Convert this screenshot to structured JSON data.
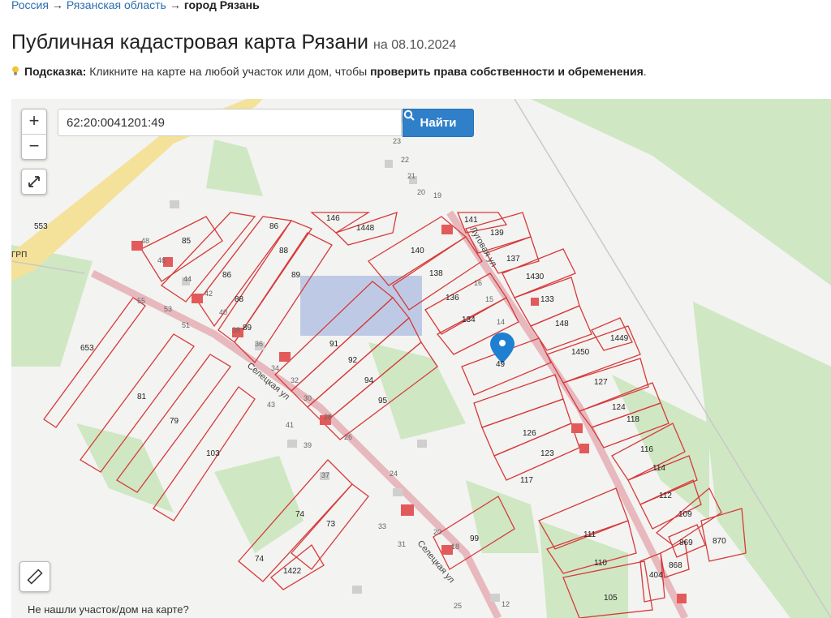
{
  "breadcrumb": {
    "items": [
      "Россия",
      "Рязанская область"
    ],
    "current": "город Рязань",
    "separator": "→"
  },
  "title": {
    "text": "Публичная кадастровая карта Рязани",
    "date": "на 08.10.2024"
  },
  "hint": {
    "label": "Подсказка:",
    "text": "Кликните на карте на любой участок или дом, чтобы",
    "bold": "проверить права собственности и обременения",
    "end": "."
  },
  "search": {
    "value": "62:20:0041201:49",
    "button_label": "Найти"
  },
  "map": {
    "zoom_in": "+",
    "zoom_out": "−",
    "not_found_text": "Не нашли участок/дом на карте?",
    "streets": [
      "Селецкая ул",
      "Луговая ул",
      "Селецкая ул"
    ],
    "other_labels": [
      "553",
      "ГРП"
    ],
    "parcels": [
      "85",
      "86",
      "86",
      "88",
      "88",
      "89",
      "89",
      "146",
      "1448",
      "140",
      "138",
      "141",
      "139",
      "137",
      "1430",
      "133",
      "136",
      "134",
      "148",
      "1449",
      "1450",
      "127",
      "124",
      "118",
      "116",
      "114",
      "112",
      "109",
      "870",
      "869",
      "868",
      "404",
      "105",
      "110",
      "111",
      "99",
      "117",
      "123",
      "126",
      "49",
      "91",
      "92",
      "94",
      "95",
      "653",
      "81",
      "79",
      "103",
      "74",
      "73",
      "1422",
      "74"
    ],
    "houses": [
      "23",
      "22",
      "21",
      "20",
      "19",
      "48",
      "46",
      "44",
      "42",
      "40",
      "38",
      "36",
      "55",
      "53",
      "51",
      "34",
      "32",
      "30",
      "28",
      "26",
      "43",
      "41",
      "39",
      "37",
      "24",
      "16",
      "15",
      "14",
      "18",
      "20",
      "33",
      "31",
      "25",
      "12"
    ],
    "colors": {
      "parcel_stroke": "#d63a3a",
      "road": "#e7b8bd",
      "green": "#cfe7c3",
      "marker": "#1f7fd1"
    }
  }
}
